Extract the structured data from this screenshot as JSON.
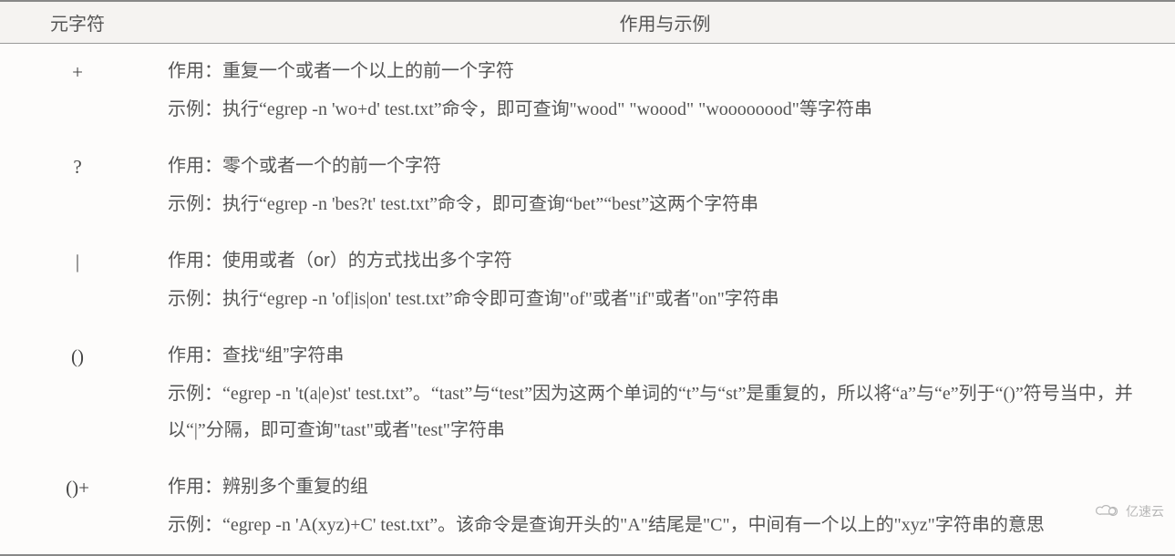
{
  "header": {
    "col_meta": "元字符",
    "col_desc": "作用与示例"
  },
  "rows": [
    {
      "meta": "+",
      "usage": "作用：重复一个或者一个以上的前一个字符",
      "example": "示例：执行“egrep -n 'wo+d' test.txt”命令，即可查询\"wood\" \"woood\" \"woooooood\"等字符串"
    },
    {
      "meta": "?",
      "usage": "作用：零个或者一个的前一个字符",
      "example": "示例：执行“egrep -n 'bes?t' test.txt”命令，即可查询“bet”“best”这两个字符串"
    },
    {
      "meta": "|",
      "usage": "作用：使用或者（or）的方式找出多个字符",
      "example": "示例：执行“egrep -n 'of|is|on' test.txt”命令即可查询\"of\"或者\"if\"或者\"on\"字符串"
    },
    {
      "meta": "()",
      "usage": "作用：查找“组”字符串",
      "example": "示例：“egrep -n 't(a|e)st' test.txt”。“tast”与“test”因为这两个单词的“t”与“st”是重复的，所以将“a”与“e”列于“()”符号当中，并以“|”分隔，即可查询\"tast\"或者\"test\"字符串"
    },
    {
      "meta": "()+",
      "usage": "作用：辨别多个重复的组",
      "example": "示例：“egrep -n 'A(xyz)+C' test.txt”。该命令是查询开头的\"A\"结尾是\"C\"，中间有一个以上的\"xyz\"字符串的意思"
    }
  ],
  "watermark": "亿速云"
}
